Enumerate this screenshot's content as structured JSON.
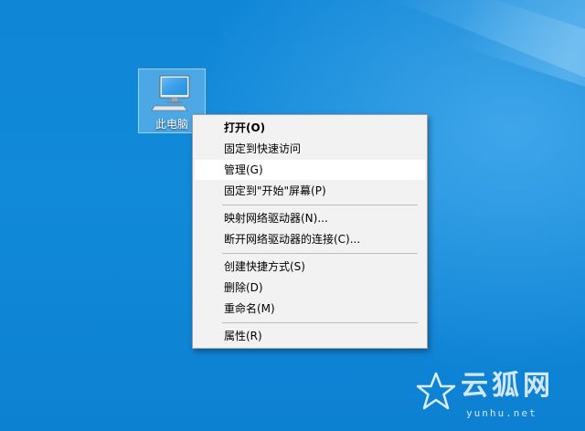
{
  "desktop": {
    "icon": {
      "label": "此电脑",
      "icon": "computer-icon"
    }
  },
  "context_menu": {
    "items": [
      {
        "label": "打开(O)",
        "bold": true
      },
      {
        "label": "固定到快速访问"
      },
      {
        "label": "管理(G)",
        "highlighted": true
      },
      {
        "label": "固定到\"开始\"屏幕(P)"
      },
      {
        "label": "映射网络驱动器(N)..."
      },
      {
        "label": "断开网络驱动器的连接(C)..."
      },
      {
        "label": "创建快捷方式(S)"
      },
      {
        "label": "删除(D)"
      },
      {
        "label": "重命名(M)"
      },
      {
        "label": "属性(R)"
      }
    ]
  },
  "watermark": {
    "text": "云狐网",
    "url": "yunhu.net",
    "icon": "star-logo-icon"
  },
  "colors": {
    "desktop_background": "#1188d8",
    "menu_background": "#f2f2f2",
    "menu_hover": "#ffffff",
    "separator": "#bcbcbc"
  }
}
